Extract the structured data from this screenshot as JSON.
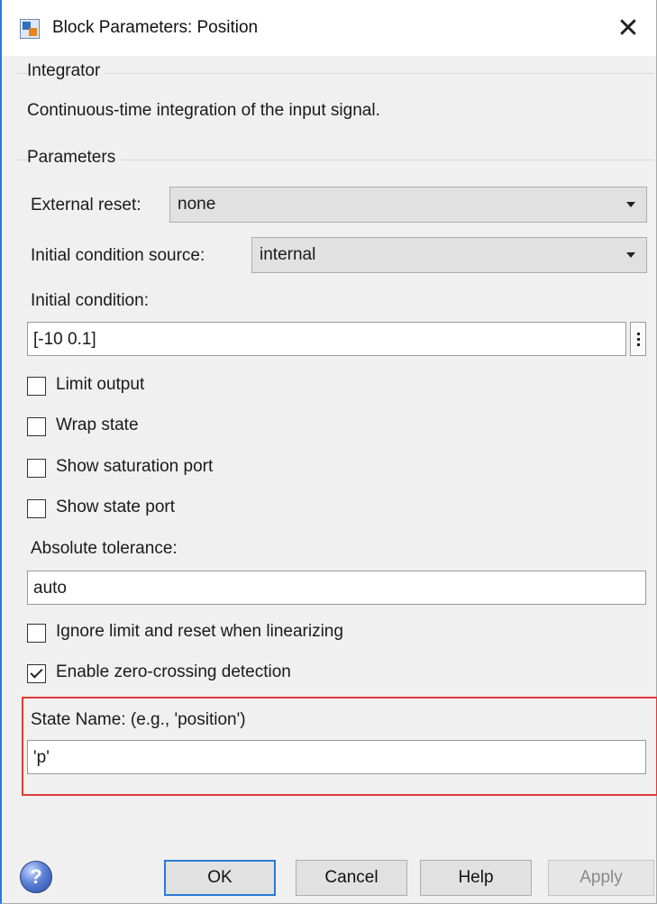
{
  "window": {
    "title": "Block Parameters: Position",
    "close_symbol": "✕"
  },
  "block": {
    "group_label": "Integrator",
    "description": "Continuous-time integration of the input signal."
  },
  "parameters": {
    "group_label": "Parameters",
    "external_reset": {
      "label": "External reset:",
      "value": "none"
    },
    "initial_condition_source": {
      "label": "Initial condition source:",
      "value": "internal"
    },
    "initial_condition": {
      "label": "Initial condition:",
      "value": "[-10 0.1]"
    },
    "checkboxes_top": [
      {
        "label": "Limit output",
        "checked": false
      },
      {
        "label": "Wrap state",
        "checked": false
      },
      {
        "label": "Show saturation port",
        "checked": false
      },
      {
        "label": "Show state port",
        "checked": false
      }
    ],
    "absolute_tolerance": {
      "label": "Absolute tolerance:",
      "value": "auto"
    },
    "checkboxes_bottom": [
      {
        "label": "Ignore limit and reset when linearizing",
        "checked": false
      },
      {
        "label": "Enable zero-crossing detection",
        "checked": true
      }
    ],
    "state_name": {
      "label": "State Name: (e.g., 'position')",
      "value": "'p'"
    }
  },
  "footer": {
    "help_icon_glyph": "?",
    "ok_label": "OK",
    "cancel_label": "Cancel",
    "help_label": "Help",
    "apply_label": "Apply"
  },
  "colors": {
    "accent": "#2b79d6",
    "highlight_border": "#e03a3a",
    "dialog_background": "#f0f0f0"
  }
}
